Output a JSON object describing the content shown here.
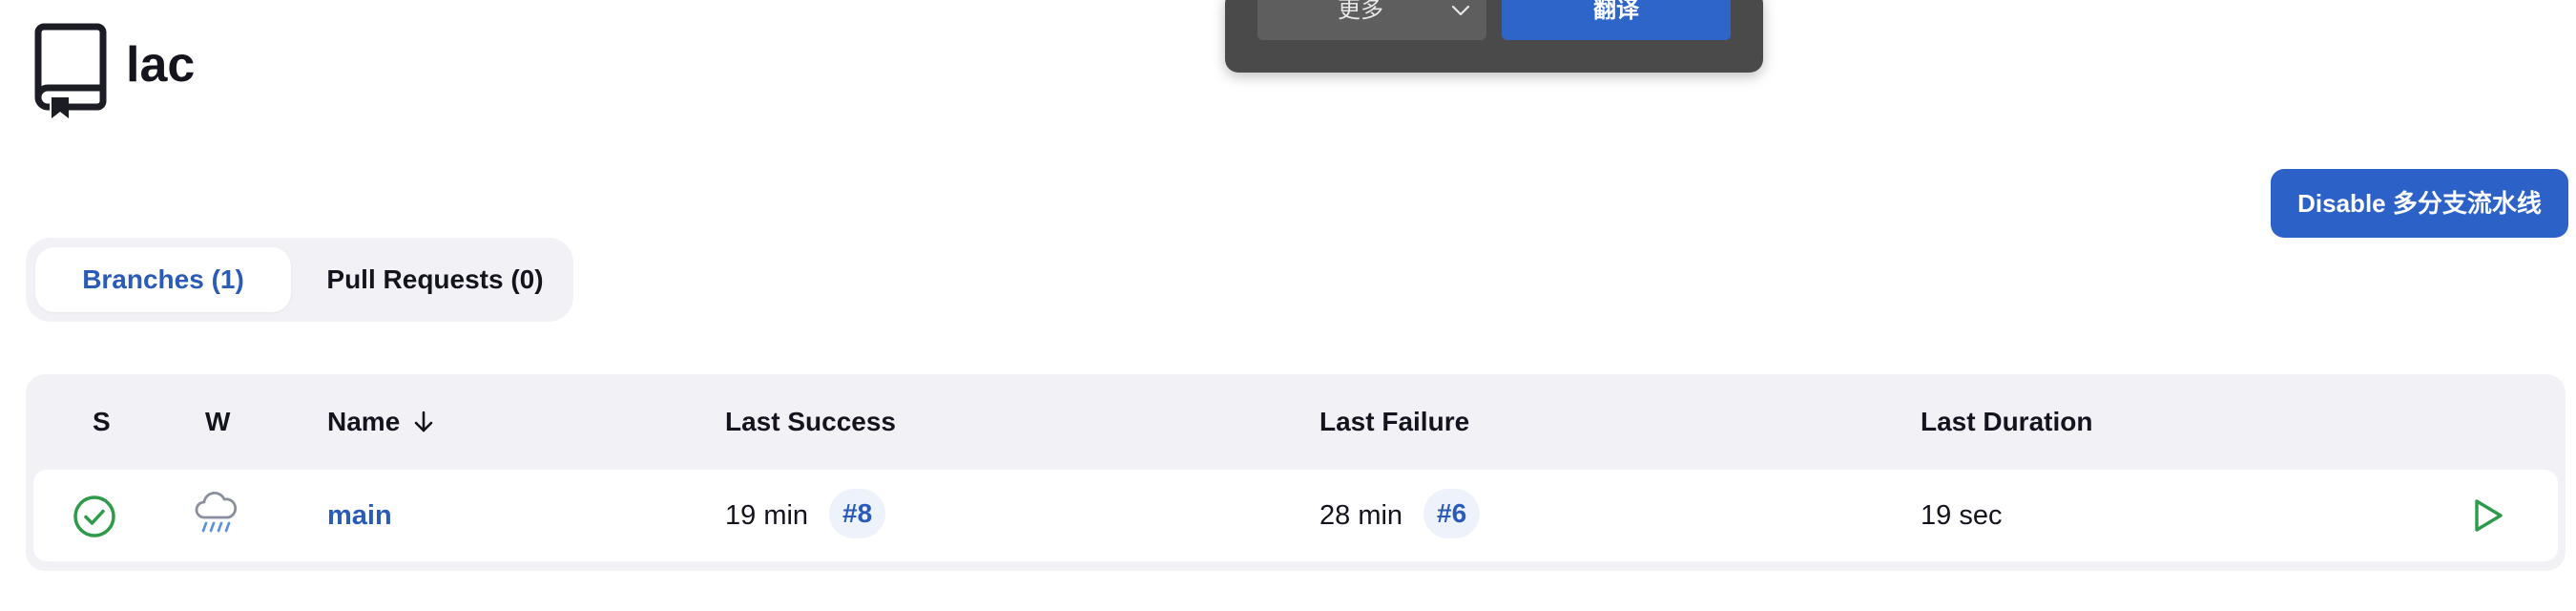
{
  "header": {
    "title": "lac",
    "icon": "repository-icon"
  },
  "translate_popup": {
    "more_label": "更多",
    "translate_label": "翻译"
  },
  "actions": {
    "disable_label": "Disable 多分支流水线"
  },
  "tabs": [
    {
      "label": "Branches (1)",
      "active": true
    },
    {
      "label": "Pull Requests (0)",
      "active": false
    }
  ],
  "table": {
    "columns": {
      "status": "S",
      "weather": "W",
      "name": "Name",
      "last_success": "Last Success",
      "last_failure": "Last Failure",
      "last_duration": "Last Duration"
    },
    "sort": "descending-arrow-icon",
    "rows": [
      {
        "status_icon": "success-check-icon",
        "weather_icon": "rain-cloud-icon",
        "name": "main",
        "last_success": "19 min",
        "last_success_build": "#8",
        "last_failure": "28 min",
        "last_failure_build": "#6",
        "last_duration": "19 sec",
        "action_icon": "run-play-icon"
      }
    ]
  },
  "colors": {
    "accent": "#2c61c7",
    "success": "#2e9b4a",
    "link": "#2a5bb8",
    "popup_bg": "#4a4a4a"
  }
}
